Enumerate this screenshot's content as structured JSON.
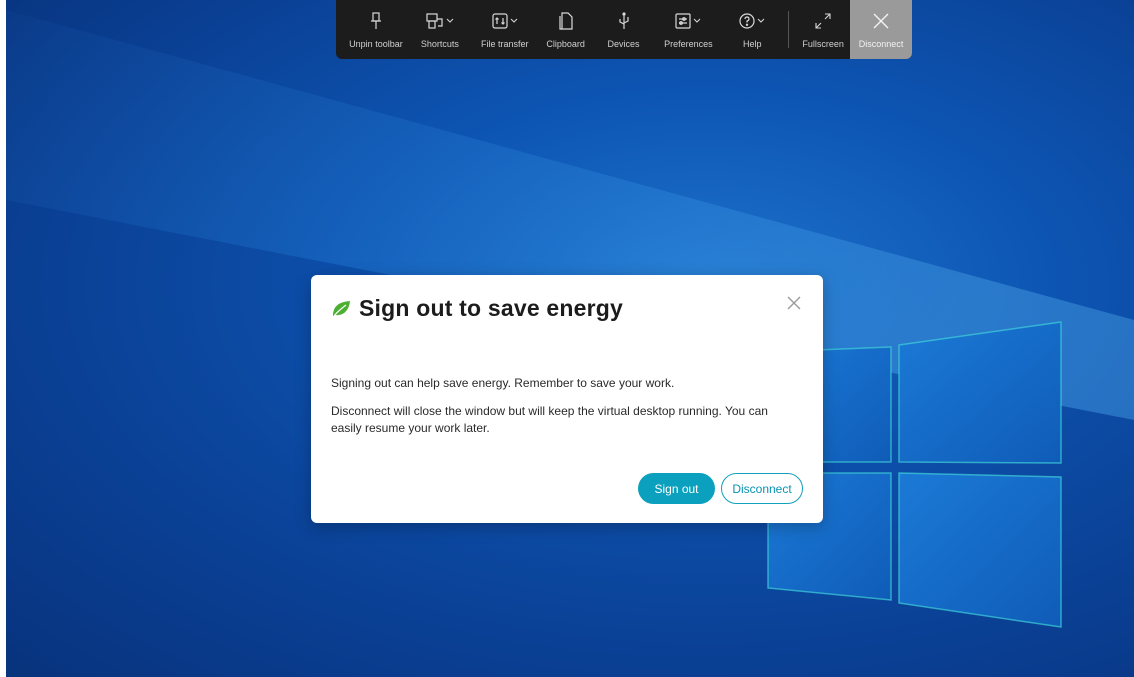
{
  "toolbar": {
    "items": [
      {
        "label": "Unpin toolbar",
        "icon": "pin-icon"
      },
      {
        "label": "Shortcuts",
        "icon": "shortcuts-icon",
        "dropdown": true
      },
      {
        "label": "File transfer",
        "icon": "file-transfer-icon",
        "dropdown": true
      },
      {
        "label": "Clipboard",
        "icon": "clipboard-icon"
      },
      {
        "label": "Devices",
        "icon": "usb-icon"
      },
      {
        "label": "Preferences",
        "icon": "preferences-icon",
        "dropdown": true
      },
      {
        "label": "Help",
        "icon": "help-icon",
        "dropdown": true
      },
      {
        "label": "Fullscreen",
        "icon": "fullscreen-icon"
      },
      {
        "label": "Disconnect",
        "icon": "close-icon"
      }
    ]
  },
  "dialog": {
    "title": "Sign out to save energy",
    "title_icon": "leaf-icon",
    "paragraph1": "Signing out can help save energy. Remember to save your work.",
    "paragraph2": "Disconnect will close the window but will keep the virtual desktop running. You can easily resume your work later.",
    "signout_label": "Sign out",
    "disconnect_label": "Disconnect"
  },
  "colors": {
    "accent": "#0aa0be",
    "leaf": "#4caf32",
    "toolbar_bg": "#1c1c1c",
    "desktop_bg": "#0d55b3"
  }
}
